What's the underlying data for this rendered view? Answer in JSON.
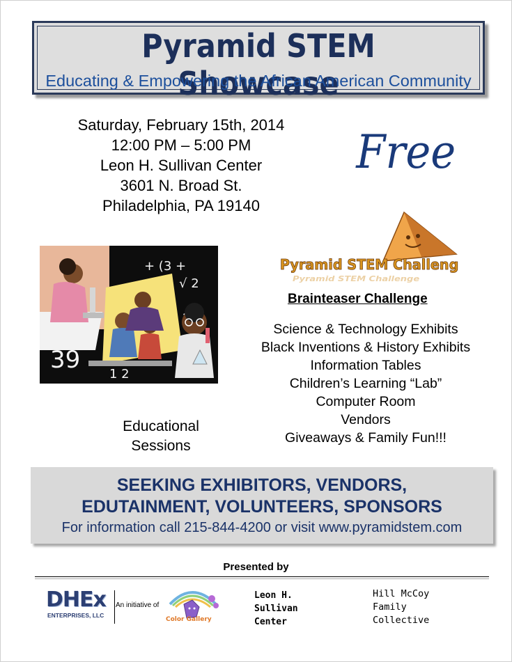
{
  "banner": {
    "title": "Pyramid STEM Showcase",
    "subtitle": "Educating & Empowering the African American Community"
  },
  "details": {
    "date": "Saturday, February 15th, 2014",
    "time": "12:00 PM – 5:00 PM",
    "venue": "Leon H. Sullivan Center",
    "street": "3601 N. Broad St.",
    "city": "Philadelphia, PA 19140"
  },
  "free_label": "Free",
  "challenge": {
    "logo_text": "Pyramid STEM Challenge",
    "heading": "Brainteaser Challenge"
  },
  "exhibits": [
    "Science & Technology Exhibits",
    "Black Inventions & History Exhibits",
    "Information Tables",
    "Children’s Learning “Lab”",
    "Computer Room",
    "Vendors",
    "Giveaways & Family Fun!!!"
  ],
  "educational": {
    "line1": "Educational",
    "line2": "Sessions"
  },
  "seeking": {
    "line1": "SEEKING EXHIBITORS, VENDORS,",
    "line2": "EDUTAINMENT, VOLUNTEERS, SPONSORS",
    "info": "For information call 215-844-4200 or visit www.pyramidstem.com"
  },
  "footer": {
    "presented_by": "Presented by",
    "dhex": "DHEx",
    "dhex_sub": "ENTERPRISES, LLC",
    "initiative": "An initiative of",
    "color_gallery": "Color Gallery",
    "sullivan": [
      "Leon H.",
      "Sullivan",
      "Center"
    ],
    "hillmccoy": [
      "Hill McCoy",
      "Family",
      "Collective"
    ]
  },
  "colors": {
    "navy": "#1c2f5a",
    "subtitle_blue": "#1c4f9c",
    "banner_bg": "#dedede",
    "seeking_bg": "#d9d9d9"
  }
}
